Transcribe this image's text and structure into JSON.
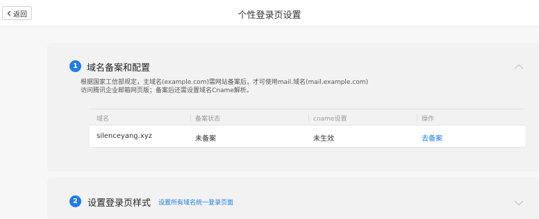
{
  "header": {
    "back_label": "返回",
    "title": "个性登录页设置"
  },
  "section1": {
    "number": "1",
    "title": "域名备案和配置",
    "desc_line1": "根据国家工信部规定，主域名(example.com)需网站备案后，才可使用mail.域名(mail.example.com)",
    "desc_line2": "访问腾讯企业邮箱网页版；备案后还需设置域名Cname解析。",
    "table": {
      "columns": [
        "域名",
        "备案状态",
        "cname设置",
        "操作"
      ],
      "rows": [
        {
          "domain": "silenceyang.xyz",
          "status": "未备案",
          "cname": "未生效",
          "action": "去备案"
        }
      ]
    }
  },
  "section2": {
    "number": "2",
    "title": "设置登录页样式",
    "link": "设置所有域名统一登录页面"
  },
  "colors": {
    "accent": "#1f7de6",
    "background": "#f7f7f7",
    "card": "#f2f2f2"
  }
}
